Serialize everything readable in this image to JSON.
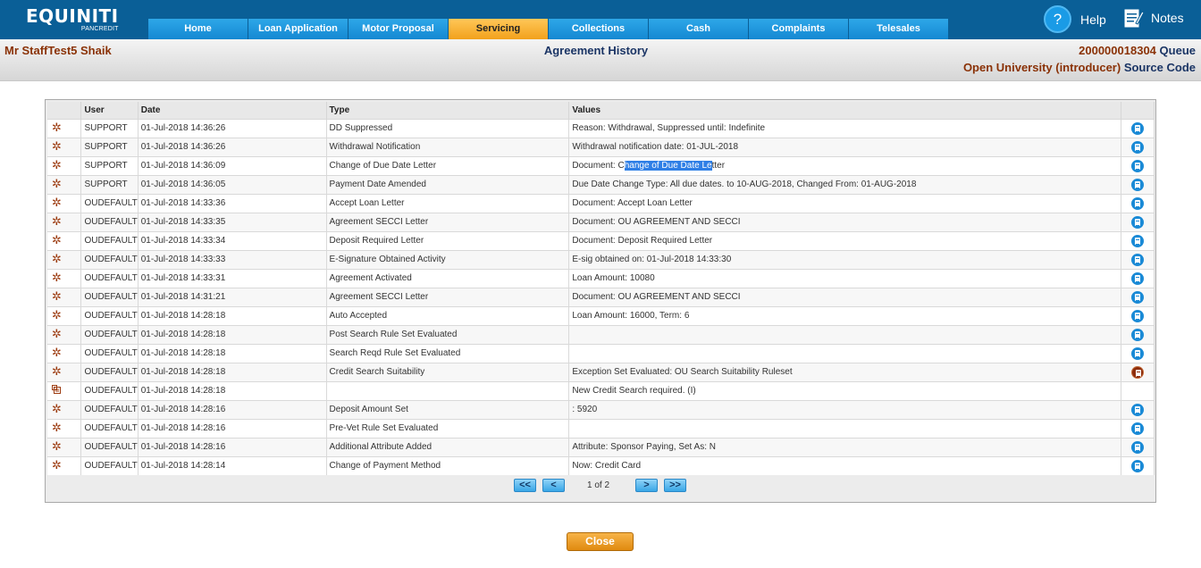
{
  "app": {
    "brand": "EQUINITI",
    "brand_sub": "PANCREDIT",
    "help_label": "Help",
    "notes_label": "Notes"
  },
  "nav": {
    "tabs": [
      "Home",
      "Loan Application",
      "Motor Proposal",
      "Servicing",
      "Collections",
      "Cash",
      "Complaints",
      "Telesales"
    ],
    "active": "Servicing"
  },
  "header": {
    "customer": "Mr StaffTest5 Shaik",
    "title": "Agreement History",
    "account_number": "200000018304",
    "account_label": "Queue",
    "source": "Open University (introducer)",
    "source_label": "Source Code"
  },
  "table": {
    "headers": [
      "",
      "User",
      "Date",
      "Type",
      "Values",
      ""
    ],
    "rows": [
      {
        "icon": "star",
        "user": "SUPPORT",
        "date": "01-Jul-2018 14:36:26",
        "type": "DD Suppressed",
        "values": "Reason: Withdrawal, Suppressed until: Indefinite",
        "action": "detail-icon"
      },
      {
        "icon": "star",
        "user": "SUPPORT",
        "date": "01-Jul-2018 14:36:26",
        "type": "Withdrawal Notification",
        "values": "Withdrawal notification date: 01-JUL-2018",
        "action": "detail-icon"
      },
      {
        "icon": "star",
        "user": "SUPPORT",
        "date": "01-Jul-2018 14:36:09",
        "type": "Change of Due Date Letter",
        "values_pre": "Document: C",
        "values_sel": "hange of Due Date Le",
        "values_post": "tter",
        "action": "detail-icon"
      },
      {
        "icon": "star",
        "user": "SUPPORT",
        "date": "01-Jul-2018 14:36:05",
        "type": "Payment Date Amended",
        "values": "Due Date Change Type: All due dates. to 10-AUG-2018, Changed From: 01-AUG-2018",
        "action": "detail-icon"
      },
      {
        "icon": "star",
        "user": "OUDEFAULT",
        "date": "01-Jul-2018 14:33:36",
        "type": "Accept Loan Letter",
        "values": "Document: Accept Loan Letter",
        "action": "detail-icon"
      },
      {
        "icon": "star",
        "user": "OUDEFAULT",
        "date": "01-Jul-2018 14:33:35",
        "type": "Agreement SECCI Letter",
        "values": "Document: OU AGREEMENT AND SECCI",
        "action": "detail-icon"
      },
      {
        "icon": "star",
        "user": "OUDEFAULT",
        "date": "01-Jul-2018 14:33:34",
        "type": "Deposit Required Letter",
        "values": "Document: Deposit Required Letter",
        "action": "detail-icon"
      },
      {
        "icon": "star",
        "user": "OUDEFAULT",
        "date": "01-Jul-2018 14:33:33",
        "type": "E-Signature Obtained Activity",
        "values": "E-sig obtained on: 01-Jul-2018 14:33:30",
        "action": "detail-icon"
      },
      {
        "icon": "star",
        "user": "OUDEFAULT",
        "date": "01-Jul-2018 14:33:31",
        "type": "Agreement Activated",
        "values": "Loan Amount: 10080",
        "action": "detail-icon"
      },
      {
        "icon": "star",
        "user": "OUDEFAULT",
        "date": "01-Jul-2018 14:31:21",
        "type": "Agreement SECCI Letter",
        "values": "Document: OU AGREEMENT AND SECCI",
        "action": "detail-icon"
      },
      {
        "icon": "star",
        "user": "OUDEFAULT",
        "date": "01-Jul-2018 14:28:18",
        "type": "Auto Accepted",
        "values": "Loan Amount: 16000, Term: 6",
        "action": "detail-icon"
      },
      {
        "icon": "star",
        "user": "OUDEFAULT",
        "date": "01-Jul-2018 14:28:18",
        "type": "Post Search Rule Set Evaluated",
        "values": "",
        "action": "detail-icon"
      },
      {
        "icon": "star",
        "user": "OUDEFAULT",
        "date": "01-Jul-2018 14:28:18",
        "type": "Search Reqd Rule Set Evaluated",
        "values": "",
        "action": "detail-icon"
      },
      {
        "icon": "star",
        "user": "OUDEFAULT",
        "date": "01-Jul-2018 14:28:18",
        "type": "Credit Search Suitability",
        "values": "Exception Set Evaluated: OU Search Suitability Ruleset",
        "action": "exception-detail-icon"
      },
      {
        "icon": "note",
        "user": "OUDEFAULT",
        "date": "01-Jul-2018 14:28:18",
        "type": "",
        "values": "New Credit Search required. (I)",
        "action": ""
      },
      {
        "icon": "star",
        "user": "OUDEFAULT",
        "date": "01-Jul-2018 14:28:16",
        "type": "Deposit Amount Set",
        "values": ": 5920",
        "action": "detail-icon"
      },
      {
        "icon": "star",
        "user": "OUDEFAULT",
        "date": "01-Jul-2018 14:28:16",
        "type": "Pre-Vet Rule Set Evaluated",
        "values": "",
        "action": "detail-icon"
      },
      {
        "icon": "star",
        "user": "OUDEFAULT",
        "date": "01-Jul-2018 14:28:16",
        "type": "Additional Attribute Added",
        "values": "Attribute: Sponsor Paying, Set As: N",
        "action": "detail-icon"
      },
      {
        "icon": "star",
        "user": "OUDEFAULT",
        "date": "01-Jul-2018 14:28:14",
        "type": "Change of Payment Method",
        "values": "Now: Credit Card",
        "action": "detail-icon"
      }
    ]
  },
  "pager": {
    "first": "<<",
    "prev": "<",
    "info": "1 of 2",
    "next": ">",
    "last": ">>"
  },
  "close_label": "Close",
  "colors": {
    "topbar": "#0a5f97",
    "tab": "#1e97de",
    "tab_active": "#f7b33a",
    "rust": "#8a3207",
    "navy": "#1b3565",
    "close": "#ea9a20"
  }
}
